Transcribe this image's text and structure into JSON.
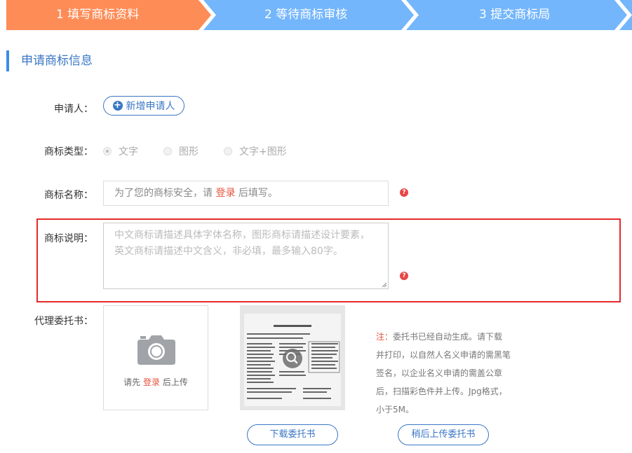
{
  "steps": [
    {
      "label": "1 填写商标资料",
      "color": "#fe8c57"
    },
    {
      "label": "2 等待商标审核",
      "color": "#74b6fb"
    },
    {
      "label": "3 提交商标局",
      "color": "#74b6fb"
    }
  ],
  "section": {
    "title": "申请商标信息"
  },
  "applicant": {
    "label": "申请人：",
    "add_button": "新增申请人"
  },
  "trademark_type": {
    "label": "商标类型：",
    "options": [
      "文字",
      "图形",
      "文字+图形"
    ],
    "selected": "文字"
  },
  "trademark_name": {
    "label": "商标名称：",
    "placeholder_before": "为了您的商标安全，请 ",
    "login_link": "登录",
    "placeholder_after": " 后填写。"
  },
  "trademark_desc": {
    "label": "商标说明：",
    "placeholder_line1": "中文商标请描述具体字体名称，图形商标请描述设计要素，",
    "placeholder_line2": "英文商标请描述中文含义，非必填，最多输入80字。"
  },
  "power_of_attorney": {
    "label": "代理委托书：",
    "upload_before": "请先 ",
    "upload_login": "登录",
    "upload_after": " 后上传",
    "note_prefix": "注：",
    "note_text": "委托书已经自动生成。请下载并打印，以自然人名义申请的需黑笔签名，以企业名义申请的需盖公章后，扫描彩色件并上传。Jpg格式，小于5M。",
    "download_button": "下载委托书",
    "later_upload_button": "稍后上传委托书"
  },
  "help_icon": "question-icon",
  "accent_color": "#3a77c5",
  "highlight_color": "#e5292b"
}
